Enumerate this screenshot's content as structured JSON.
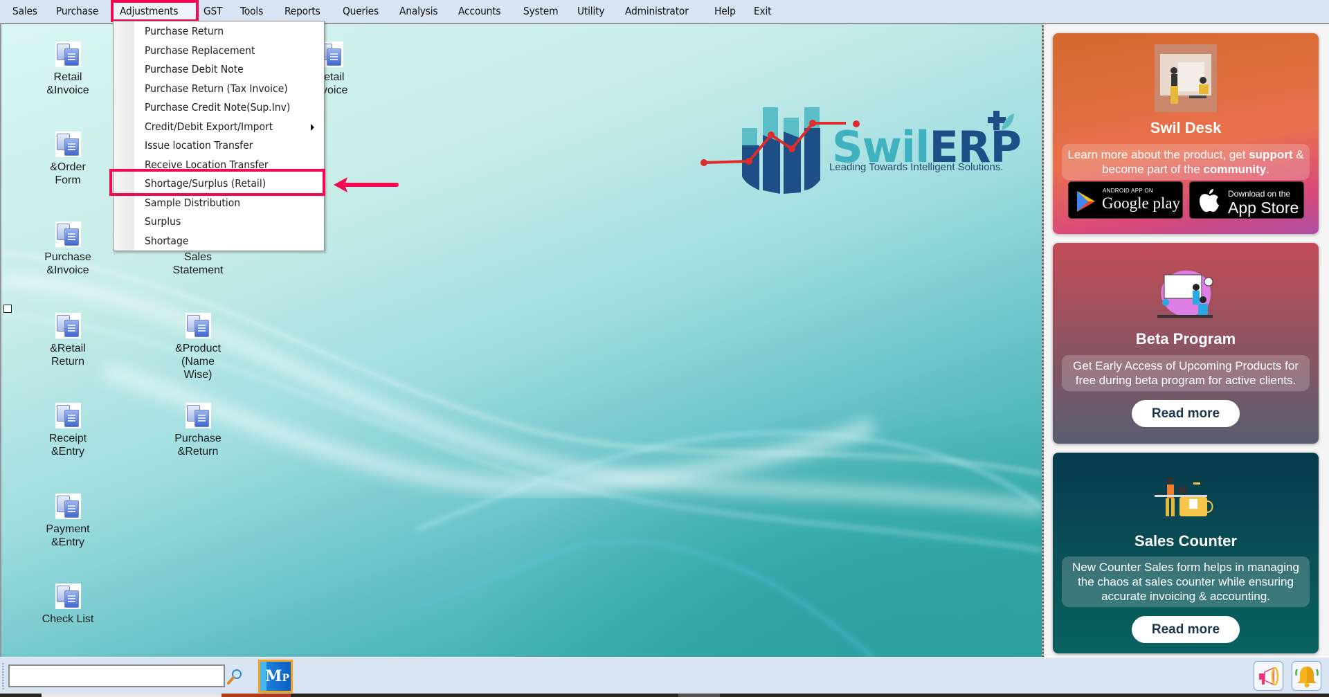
{
  "menubar": {
    "items": [
      {
        "label": "Sales"
      },
      {
        "label": "Purchase"
      },
      {
        "label": "Adjustments",
        "active": true
      },
      {
        "label": "GST"
      },
      {
        "label": "Tools"
      },
      {
        "label": "Reports"
      },
      {
        "label": "Queries"
      },
      {
        "label": "Analysis"
      },
      {
        "label": "Accounts"
      },
      {
        "label": "System"
      },
      {
        "label": "Utility"
      },
      {
        "label": "Administrator"
      },
      {
        "label": "Help"
      },
      {
        "label": "Exit"
      }
    ]
  },
  "dropdown": {
    "parent": "Adjustments",
    "items": [
      {
        "label": "Purchase Return"
      },
      {
        "label": "Purchase Replacement"
      },
      {
        "label": "Purchase Debit Note"
      },
      {
        "label": "Purchase Return (Tax Invoice)"
      },
      {
        "label": "Purchase Credit Note(Sup.Inv)"
      },
      {
        "label": "Credit/Debit Export/Import",
        "has_submenu": true
      },
      {
        "label": "Issue location Transfer"
      },
      {
        "label": "Receive Location Transfer"
      },
      {
        "label": "Shortage/Surplus (Retail)",
        "highlighted": true
      },
      {
        "label": "Sample Distribution"
      },
      {
        "label": "Surplus"
      },
      {
        "label": "Shortage"
      }
    ]
  },
  "shortcuts": [
    {
      "label": "Retail\n&Invoice"
    },
    {
      "label": "&Order\nForm"
    },
    {
      "label": "Purchase\n&Invoice"
    },
    {
      "label": "&Retail\nReturn"
    },
    {
      "label": "Receipt\n&Entry"
    },
    {
      "label": "Payment\n&Entry"
    },
    {
      "label": "Check List"
    },
    {
      "label": "Sales\nStatement"
    },
    {
      "label": "&Product\n(Name\nWise)"
    },
    {
      "label": "Purchase\n&Return"
    },
    {
      "label": "Retail\nInvoice"
    }
  ],
  "logo": {
    "word_part1": "Swil",
    "word_part2": "ERP",
    "tagline": "Leading Towards Intelligent Solutions."
  },
  "cards": [
    {
      "title": "Swil Desk",
      "desc_parts": [
        "Learn more about the product, get ",
        "support",
        " & become part of the ",
        "community",
        "."
      ],
      "google_play_small": "ANDROID APP ON",
      "google_play_big": "Google play",
      "app_store_small": "Download on the",
      "app_store_big": "App Store"
    },
    {
      "title": "Beta Program",
      "desc": "Get Early Access of Upcoming Products for free during beta program for active clients.",
      "button": "Read more"
    },
    {
      "title": "Sales Counter",
      "desc": "New Counter Sales form helps in managing the chaos at sales counter while ensuring accurate invoicing & accounting.",
      "button": "Read more"
    }
  ],
  "taskbar": {
    "search_value": "",
    "mp_label": "M",
    "mp_label_small": "P"
  },
  "colors": {
    "annotation_red": "#f5084f",
    "menubar_bg": "#d8e4f2",
    "logo_teal": "#3fb1bf",
    "logo_navy": "#1d4f86"
  }
}
